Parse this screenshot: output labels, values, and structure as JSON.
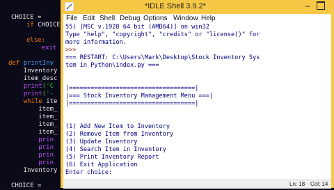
{
  "bg_code": {
    "l1a": "CHOICE = ",
    "l2a": "if ",
    "l2b": "CHOICE",
    "l3a": "    ",
    "l4a": "else:",
    "l5a": "    exit",
    "l6a": "def ",
    "l6b": "printInv",
    "l7": "    Inventory",
    "l8": "    item_desc",
    "l9a": "    ",
    "l9b": "print",
    "l9c": "('C",
    "l10a": "    ",
    "l10b": "print",
    "l10c": "('-",
    "l11a": "    while ",
    "l11b": "ite",
    "l12": "        item_",
    "l13": "        item_",
    "l14": "        item_",
    "l15": "        item_",
    "l16": "        prin",
    "l17": "        prin",
    "l18": "        prin",
    "l19": "        prin",
    "l20": "    Inventory",
    "l21a": "CHOICE = ",
    "l21b": ""
  },
  "window": {
    "title": "*IDLE Shell 3.9.2*",
    "minimize": "–",
    "menu": [
      "File",
      "Edit",
      "Shell",
      "Debug",
      "Options",
      "Window",
      "Help"
    ]
  },
  "shell": {
    "lines": [
      "55) [MSC v.1928 64 bit (AMD64)] on win32",
      "Type \"help\", \"copyright\", \"credits\" or \"license()\" for",
      "more information.",
      ">>> ",
      "=== RESTART: C:\\Users\\Mark\\Desktop\\Stock Inventory Sys",
      "tem in Python\\index.py ===",
      "",
      "",
      "|===================================|",
      "|=== Stock Inventory Management Menu ===|",
      "|===================================|",
      "",
      "",
      "(1) Add New Item to Inventory",
      "(2) Remove Item from Inventory",
      "(3) Update Inventory",
      "(4) Search Item in Inventory",
      "(5) Print Inventory Report",
      "(6) Exit Application",
      "Enter choice:"
    ]
  },
  "status": {
    "line": "Ln: 18",
    "col": "Col: 14"
  }
}
